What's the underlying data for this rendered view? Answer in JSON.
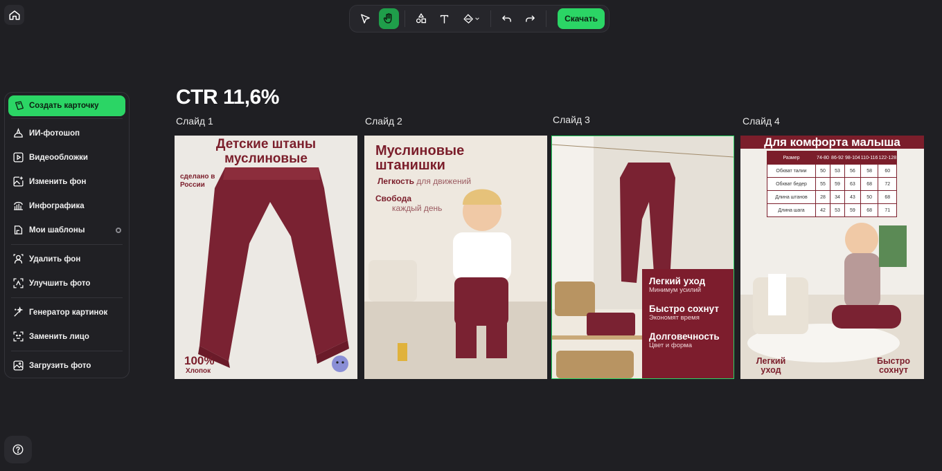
{
  "toolbar": {
    "tools": [
      "select-tool",
      "hand-tool",
      "shapes-tool",
      "text-tool",
      "fill-tool"
    ],
    "download_label": "Скачать"
  },
  "sidebar": {
    "create_label": "Создать карточку",
    "items": [
      {
        "label": "ИИ-фотошоп",
        "icon": "ai-photoshop-icon"
      },
      {
        "label": "Видеообложки",
        "icon": "video-cover-icon"
      },
      {
        "label": "Изменить фон",
        "icon": "change-background-icon"
      },
      {
        "label": "Инфографика",
        "icon": "infographic-icon"
      },
      {
        "label": "Мои шаблоны",
        "icon": "templates-icon"
      },
      {
        "label": "Удалить фон",
        "icon": "remove-background-icon"
      },
      {
        "label": "Улучшить фото",
        "icon": "enhance-photo-icon"
      },
      {
        "label": "Генератор картинок",
        "icon": "image-generator-icon"
      },
      {
        "label": "Заменить лицо",
        "icon": "face-swap-icon"
      },
      {
        "label": "Загрузить фото",
        "icon": "upload-photo-icon"
      }
    ]
  },
  "canvas": {
    "title": "CTR 11,6%",
    "slides": [
      {
        "label": "Слайд 1"
      },
      {
        "label": "Слайд 2"
      },
      {
        "label": "Слайд 3"
      },
      {
        "label": "Слайд 4"
      }
    ]
  },
  "slide1": {
    "title": "Детские штаны муслиновые",
    "note": "сделано в России",
    "big": "100%",
    "sub": "Хлопок"
  },
  "slide2": {
    "title": "Муслиновые штанишки",
    "line1_bold": "Легкость",
    "line1_rest": "для движений",
    "line2_bold": "Свобода",
    "line2_rest": "каждый день"
  },
  "slide3": {
    "items": [
      {
        "h": "Легкий уход",
        "s": "Минимум усилий"
      },
      {
        "h": "Быстро сохнут",
        "s": "Экономят время"
      },
      {
        "h": "Долговечность",
        "s": "Цвет и форма"
      }
    ]
  },
  "slide4": {
    "banner": "Для комфорта малыша",
    "table_header": [
      "Размер",
      "74-80",
      "86-92",
      "98-104",
      "110-116",
      "122-128"
    ],
    "table_rows": [
      [
        "Обхват талии",
        "50",
        "53",
        "56",
        "58",
        "60"
      ],
      [
        "Обхват бедер",
        "55",
        "59",
        "63",
        "68",
        "72"
      ],
      [
        "Длина штанов",
        "28",
        "34",
        "43",
        "50",
        "68"
      ],
      [
        "Длина шага",
        "42",
        "53",
        "59",
        "68",
        "71"
      ]
    ],
    "left_caption": "Легкий уход",
    "right_caption": "Быстро сохнут"
  },
  "colors": {
    "accent": "#2bd565",
    "brand_burgundy": "#7b1e2b",
    "background": "#1f1f23"
  }
}
